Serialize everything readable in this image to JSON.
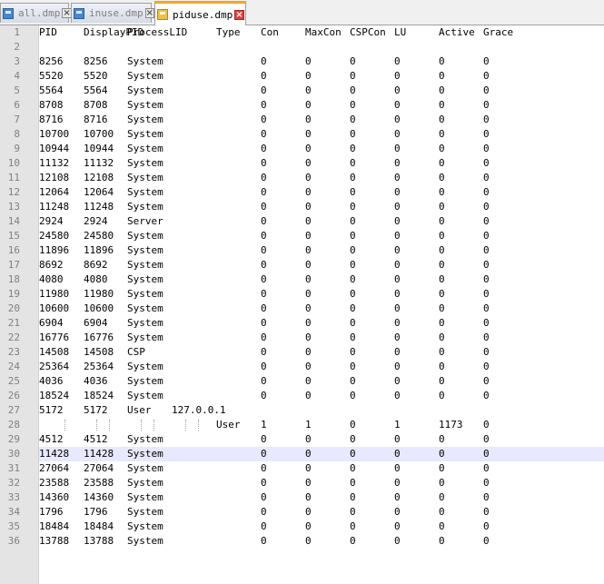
{
  "tabs": [
    {
      "label": "all.dmp",
      "active": false
    },
    {
      "label": "inuse.dmp",
      "active": false
    },
    {
      "label": "piduse.dmp",
      "active": true
    }
  ],
  "editor": {
    "current_line": 30,
    "rows": [
      [
        "PID",
        "DisplayPID",
        "ProcessLID",
        "Type",
        "Con",
        "MaxCon",
        "CSPCon",
        "LU",
        "Active",
        "Grace"
      ],
      [],
      [
        "8256",
        "8256",
        "System",
        "",
        "0",
        "0",
        "0",
        "0",
        "0",
        "0"
      ],
      [
        "5520",
        "5520",
        "System",
        "",
        "0",
        "0",
        "0",
        "0",
        "0",
        "0"
      ],
      [
        "5564",
        "5564",
        "System",
        "",
        "0",
        "0",
        "0",
        "0",
        "0",
        "0"
      ],
      [
        "8708",
        "8708",
        "System",
        "",
        "0",
        "0",
        "0",
        "0",
        "0",
        "0"
      ],
      [
        "8716",
        "8716",
        "System",
        "",
        "0",
        "0",
        "0",
        "0",
        "0",
        "0"
      ],
      [
        "10700",
        "10700",
        "System",
        "",
        "0",
        "0",
        "0",
        "0",
        "0",
        "0"
      ],
      [
        "10944",
        "10944",
        "System",
        "",
        "0",
        "0",
        "0",
        "0",
        "0",
        "0"
      ],
      [
        "11132",
        "11132",
        "System",
        "",
        "0",
        "0",
        "0",
        "0",
        "0",
        "0"
      ],
      [
        "12108",
        "12108",
        "System",
        "",
        "0",
        "0",
        "0",
        "0",
        "0",
        "0"
      ],
      [
        "12064",
        "12064",
        "System",
        "",
        "0",
        "0",
        "0",
        "0",
        "0",
        "0"
      ],
      [
        "11248",
        "11248",
        "System",
        "",
        "0",
        "0",
        "0",
        "0",
        "0",
        "0"
      ],
      [
        "2924",
        "2924",
        "Server",
        "",
        "0",
        "0",
        "0",
        "0",
        "0",
        "0"
      ],
      [
        "24580",
        "24580",
        "System",
        "",
        "0",
        "0",
        "0",
        "0",
        "0",
        "0"
      ],
      [
        "11896",
        "11896",
        "System",
        "",
        "0",
        "0",
        "0",
        "0",
        "0",
        "0"
      ],
      [
        "8692",
        "8692",
        "System",
        "",
        "0",
        "0",
        "0",
        "0",
        "0",
        "0"
      ],
      [
        "4080",
        "4080",
        "System",
        "",
        "0",
        "0",
        "0",
        "0",
        "0",
        "0"
      ],
      [
        "11980",
        "11980",
        "System",
        "",
        "0",
        "0",
        "0",
        "0",
        "0",
        "0"
      ],
      [
        "10600",
        "10600",
        "System",
        "",
        "0",
        "0",
        "0",
        "0",
        "0",
        "0"
      ],
      [
        "6904",
        "6904",
        "System",
        "",
        "0",
        "0",
        "0",
        "0",
        "0",
        "0"
      ],
      [
        "16776",
        "16776",
        "System",
        "",
        "0",
        "0",
        "0",
        "0",
        "0",
        "0"
      ],
      [
        "14508",
        "14508",
        "CSP",
        "",
        "0",
        "0",
        "0",
        "0",
        "0",
        "0"
      ],
      [
        "25364",
        "25364",
        "System",
        "",
        "0",
        "0",
        "0",
        "0",
        "0",
        "0"
      ],
      [
        "4036",
        "4036",
        "System",
        "",
        "0",
        "0",
        "0",
        "0",
        "0",
        "0"
      ],
      [
        "18524",
        "18524",
        "System",
        "",
        "0",
        "0",
        "0",
        "0",
        "0",
        "0"
      ],
      [
        "5172",
        "5172",
        "User",
        "127.0.0.1"
      ],
      [
        "",
        "",
        "",
        "User",
        "1",
        "1",
        "0",
        "1",
        "1173",
        "0"
      ],
      [
        "4512",
        "4512",
        "System",
        "",
        "0",
        "0",
        "0",
        "0",
        "0",
        "0"
      ],
      [
        "11428",
        "11428",
        "System",
        "",
        "0",
        "0",
        "0",
        "0",
        "0",
        "0"
      ],
      [
        "27064",
        "27064",
        "System",
        "",
        "0",
        "0",
        "0",
        "0",
        "0",
        "0"
      ],
      [
        "23588",
        "23588",
        "System",
        "",
        "0",
        "0",
        "0",
        "0",
        "0",
        "0"
      ],
      [
        "14360",
        "14360",
        "System",
        "",
        "0",
        "0",
        "0",
        "0",
        "0",
        "0"
      ],
      [
        "1796",
        "1796",
        "System",
        "",
        "0",
        "0",
        "0",
        "0",
        "0",
        "0"
      ],
      [
        "18484",
        "18484",
        "System",
        "",
        "0",
        "0",
        "0",
        "0",
        "0",
        "0"
      ],
      [
        "13788",
        "13788",
        "System",
        "",
        "0",
        "0",
        "0",
        "0",
        "0",
        "0"
      ]
    ]
  }
}
